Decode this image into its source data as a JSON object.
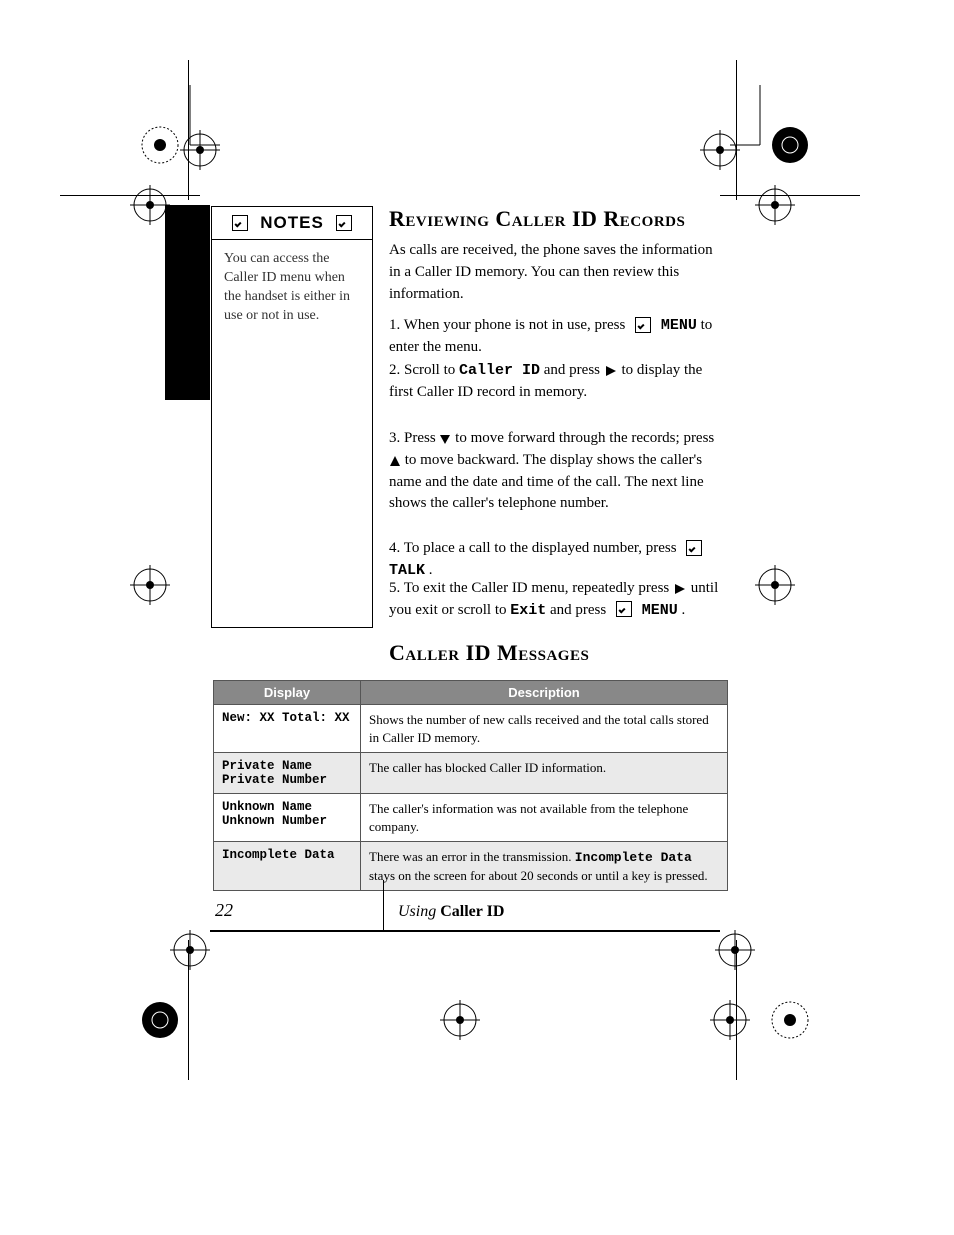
{
  "page_number": "22",
  "footer": {
    "left_italic": "Using",
    "left_bold": "Caller ID"
  },
  "notes": {
    "heading": "NOTES",
    "body": "You can access the Caller ID menu when the handset is either in use or not in use."
  },
  "sections": {
    "review": {
      "title": "Reviewing Caller ID Records",
      "para1": "As calls are received, the phone saves the information in a Caller ID memory. You can then review this information.",
      "step1a": "1. When your phone is not in use, press ",
      "step1b": " to enter the menu.",
      "step2a": "2. Scroll to ",
      "step2b": " and press ",
      "step2c": " to display the first Caller ID record in memory.",
      "step3a": "3. Press ",
      "step3b": " to move forward through the records; press ",
      "step3c": " to move backward. The display shows the caller's name and the date and time of the call. The next line shows the caller's telephone number.",
      "step4a": "4. To place a call to the displayed number, press ",
      "step4b": ".",
      "step5a": "5. To exit the Caller ID menu, repeatedly press ",
      "step5b": " until you exit or scroll to ",
      "step5c": " and press ",
      "step5d": ".",
      "menu_callerid": "Caller ID",
      "menu_exit": "Exit"
    },
    "messages": {
      "title": "Caller ID Messages",
      "table": {
        "headers": [
          "Display",
          "Description"
        ],
        "rows": [
          {
            "display": "New: XX Total: XX",
            "desc": "Shows the number of new calls received and the total calls stored in Caller ID memory."
          },
          {
            "display": "Private Name Private Number",
            "desc": "The caller has blocked Caller ID information."
          },
          {
            "display": "Unknown Name Unknown Number",
            "desc": "The caller's information was not available from the telephone company."
          },
          {
            "display": "Incomplete Data",
            "desc_a": "There was an error in the transmission. ",
            "desc_b": "Incomplete Data",
            "desc_c": " stays on the screen for about 20 seconds or until a key is pressed."
          }
        ]
      }
    }
  },
  "keys": {
    "menu": "MENU",
    "talk": "TALK"
  }
}
